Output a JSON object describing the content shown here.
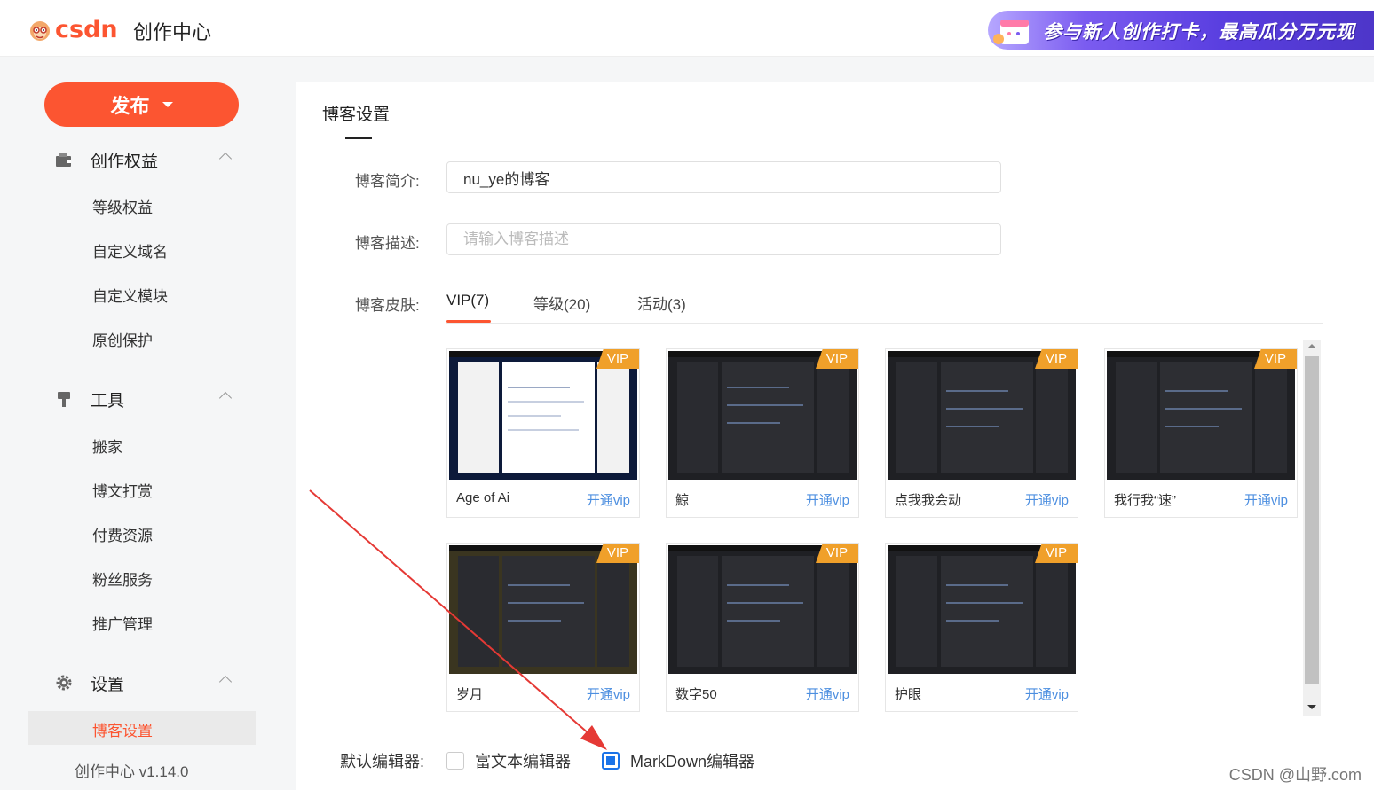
{
  "header": {
    "logo_text": "csdn",
    "title": "创作中心",
    "banner_text": "参与新人创作打卡，最高瓜分万元现"
  },
  "sidebar": {
    "publish_label": "发布",
    "groups": [
      {
        "label": "创作权益",
        "items": [
          "等级权益",
          "自定义域名",
          "自定义模块",
          "原创保护"
        ]
      },
      {
        "label": "工具",
        "items": [
          "搬家",
          "博文打赏",
          "付费资源",
          "粉丝服务",
          "推广管理"
        ]
      },
      {
        "label": "设置",
        "items": [
          "博客设置"
        ],
        "active": "博客设置"
      }
    ],
    "version": "创作中心 v1.14.0"
  },
  "main": {
    "title": "博客设置",
    "intro_label": "博客简介:",
    "intro_value": "nu_ye的博客",
    "desc_label": "博客描述:",
    "desc_placeholder": "请输入博客描述",
    "skin_label": "博客皮肤:",
    "tabs": [
      "VIP(7)",
      "等级(20)",
      "活动(3)"
    ],
    "active_tab": "VIP(7)",
    "skins": [
      {
        "name": "Age of Ai",
        "badge": "VIP",
        "action": "开通vip"
      },
      {
        "name": "鯨",
        "badge": "VIP",
        "action": "开通vip"
      },
      {
        "name": "点我我会动",
        "badge": "VIP",
        "action": "开通vip"
      },
      {
        "name": "我行我“速”",
        "badge": "VIP",
        "action": "开通vip"
      },
      {
        "name": "岁月",
        "badge": "VIP",
        "action": "开通vip"
      },
      {
        "name": "数字50",
        "badge": "VIP",
        "action": "开通vip"
      },
      {
        "name": "护眼",
        "badge": "VIP",
        "action": "开通vip"
      }
    ],
    "editor_label": "默认编辑器:",
    "editor_options": [
      "富文本编辑器",
      "MarkDown编辑器"
    ],
    "editor_selected": "MarkDown编辑器"
  },
  "watermark": "CSDN @山野.com",
  "colors": {
    "accent": "#fc5531",
    "link": "#4d8fe0",
    "vip_badge": "#f0a02a",
    "checkbox": "#1a73e8",
    "annotation_arrow": "#e53935"
  }
}
